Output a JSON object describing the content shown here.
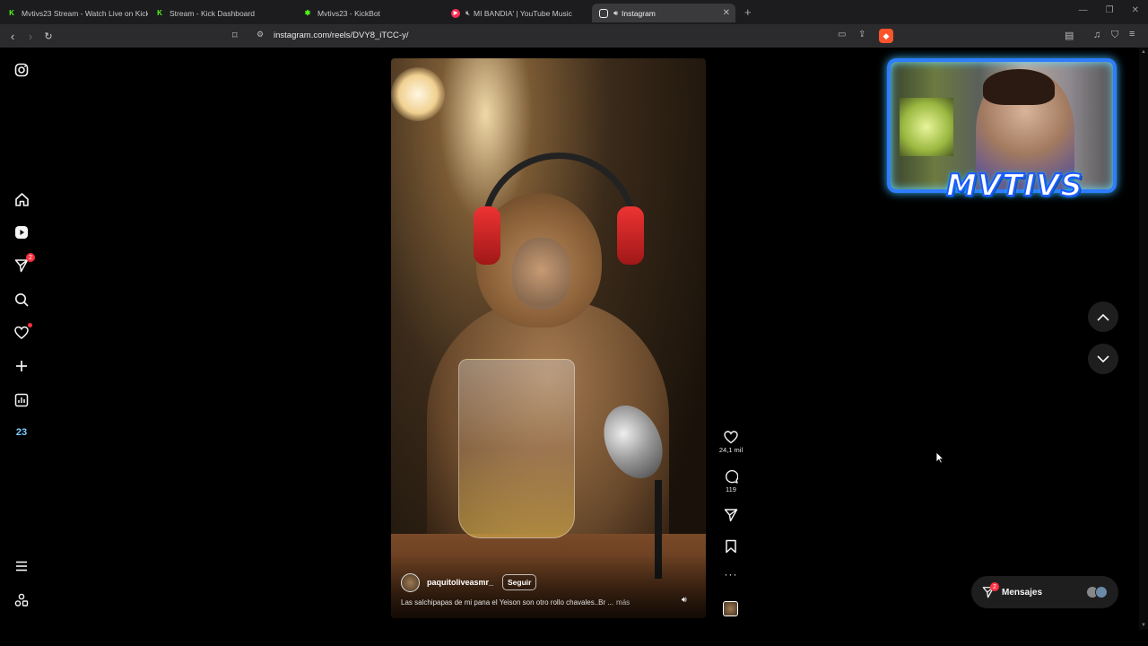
{
  "browser": {
    "tabs": [
      {
        "title": "Mvtivs23 Stream - Watch Live on Kick",
        "favicon": "kick-icon"
      },
      {
        "title": "Stream - Kick Dashboard",
        "favicon": "kick-icon"
      },
      {
        "title": "Mvtivs23 - KickBot",
        "favicon": "kickbot-icon"
      },
      {
        "title": "MI BANDIA' | YouTube Music",
        "favicon": "youtube-music-icon"
      },
      {
        "title": "Instagram",
        "favicon": "instagram-icon",
        "active": true
      }
    ],
    "url": "instagram.com/reels/DVY8_iTCC-y/"
  },
  "sidebar": {
    "items": [
      {
        "name": "instagram-logo",
        "icon": "instagram-icon"
      },
      {
        "name": "home",
        "icon": "home-icon"
      },
      {
        "name": "reels",
        "icon": "reels-icon"
      },
      {
        "name": "messages",
        "icon": "send-icon",
        "badge": "2"
      },
      {
        "name": "search",
        "icon": "search-icon"
      },
      {
        "name": "notifications",
        "icon": "heart-icon"
      },
      {
        "name": "create",
        "icon": "plus-icon"
      },
      {
        "name": "dashboard",
        "icon": "chart-icon"
      },
      {
        "name": "profile",
        "icon": "profile-icon",
        "label": "23"
      },
      {
        "name": "more",
        "icon": "menu-icon"
      },
      {
        "name": "also-from-meta",
        "icon": "apps-icon"
      }
    ]
  },
  "reel": {
    "username": "paquitoliveasmr_",
    "follow_label": "Seguir",
    "caption": "Las salchipapas de mi pana el Yeison son otro rollo chavales..Br ...",
    "more_label": "más",
    "actions": {
      "likes": "24,1 mil",
      "comments": "119"
    }
  },
  "messages_bar": {
    "label": "Mensajes",
    "badge": "2"
  },
  "overlay": {
    "streamer_name": "MVTIVS"
  },
  "colors": {
    "accent_badge": "#ff3040",
    "kick_green": "#53fc18",
    "overlay_blue": "#2f7cff"
  }
}
